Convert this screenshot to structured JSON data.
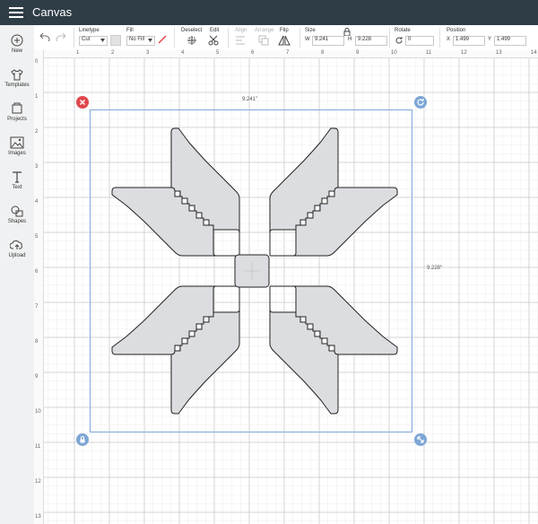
{
  "app": {
    "title": "Canvas"
  },
  "sidebar": {
    "items": [
      {
        "label": "New"
      },
      {
        "label": "Templates"
      },
      {
        "label": "Projects"
      },
      {
        "label": "Images"
      },
      {
        "label": "Text"
      },
      {
        "label": "Shapes"
      },
      {
        "label": "Upload"
      }
    ]
  },
  "toolbar": {
    "linetype_label": "Linetype",
    "linetype_value": "Cut",
    "fill_label": "Fill",
    "fill_value": "No Fill",
    "deselect_label": "Deselect",
    "edit_label": "Edit",
    "align_label": "Align",
    "arrange_label": "Arrange",
    "flip_label": "Flip",
    "size_label": "Size",
    "w_label": "W",
    "w_value": "9.241",
    "h_label": "H",
    "h_value": "9.228",
    "rotate_label": "Rotate",
    "rotate_value": "0",
    "position_label": "Position",
    "x_label": "X",
    "x_value": "1.499",
    "y_label": "Y",
    "y_value": "1.499"
  },
  "rulers": {
    "top": [
      "1",
      "2",
      "3",
      "4",
      "5",
      "6",
      "7",
      "8",
      "9",
      "10",
      "11",
      "12",
      "13",
      "14"
    ],
    "left": [
      "0",
      "1",
      "2",
      "3",
      "4",
      "5",
      "6",
      "7",
      "8",
      "9",
      "10",
      "11",
      "12",
      "13"
    ]
  },
  "selection": {
    "width_label": "9.241\"",
    "height_label": "9.228\""
  },
  "colors": {
    "topbar": "#2f3d46",
    "selection_box": "#7ea6d6",
    "delete_handle": "#e0474c",
    "handle": "#7ea6d6",
    "shape_fill": "#dcdde0",
    "grid_major": "#c9c9c9",
    "grid_minor": "#ececec"
  },
  "icons": {
    "menu": "hamburger-icon",
    "undo": "undo-icon",
    "redo": "redo-icon",
    "delete": "close-icon",
    "rotate": "rotate-icon",
    "lock": "lock-icon",
    "resize": "resize-icon"
  }
}
